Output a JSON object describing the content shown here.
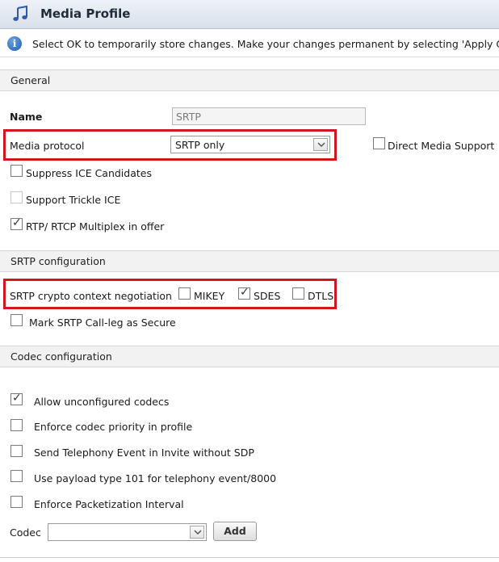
{
  "header": {
    "title": "Media Profile"
  },
  "info": {
    "message": "Select OK to temporarily store changes. Make your changes permanent by selecting 'Apply Cha"
  },
  "general": {
    "section_label": "General",
    "name_label": "Name",
    "name_value": "SRTP",
    "media_protocol_label": "Media protocol",
    "media_protocol_value": "SRTP only",
    "direct_media_label": "Direct Media Support",
    "direct_media_checked": false,
    "suppress_ice_label": "Suppress ICE Candidates",
    "suppress_ice_checked": false,
    "trickle_ice_label": "Support Trickle ICE",
    "trickle_ice_checked": false,
    "rtcp_mux_label": "RTP/ RTCP Multiplex in offer",
    "rtcp_mux_checked": true
  },
  "srtp": {
    "section_label": "SRTP configuration",
    "negotiation_label": "SRTP crypto context negotiation",
    "mikey_label": "MIKEY",
    "mikey_checked": false,
    "sdes_label": "SDES",
    "sdes_checked": true,
    "dtls_label": "DTLS",
    "dtls_checked": false,
    "secure_leg_label": "Mark SRTP Call-leg as Secure",
    "secure_leg_checked": false
  },
  "codec": {
    "section_label": "Codec configuration",
    "options": [
      {
        "label": "Allow unconfigured codecs",
        "checked": true
      },
      {
        "label": "Enforce codec priority in profile",
        "checked": false
      },
      {
        "label": "Send Telephony Event in Invite without SDP",
        "checked": false
      },
      {
        "label": "Use payload type 101 for telephony event/8000",
        "checked": false
      },
      {
        "label": "Enforce Packetization Interval",
        "checked": false
      }
    ],
    "codec_label": "Codec",
    "codec_value": "",
    "add_button": "Add"
  },
  "colors": {
    "highlight": "#d0171f",
    "header_bg": "#dfe5ee",
    "section_bg": "#f2f2f2"
  },
  "icons": {
    "title": "music-note-icon",
    "info": "info-icon",
    "dropdown": "chevron-down-icon"
  }
}
